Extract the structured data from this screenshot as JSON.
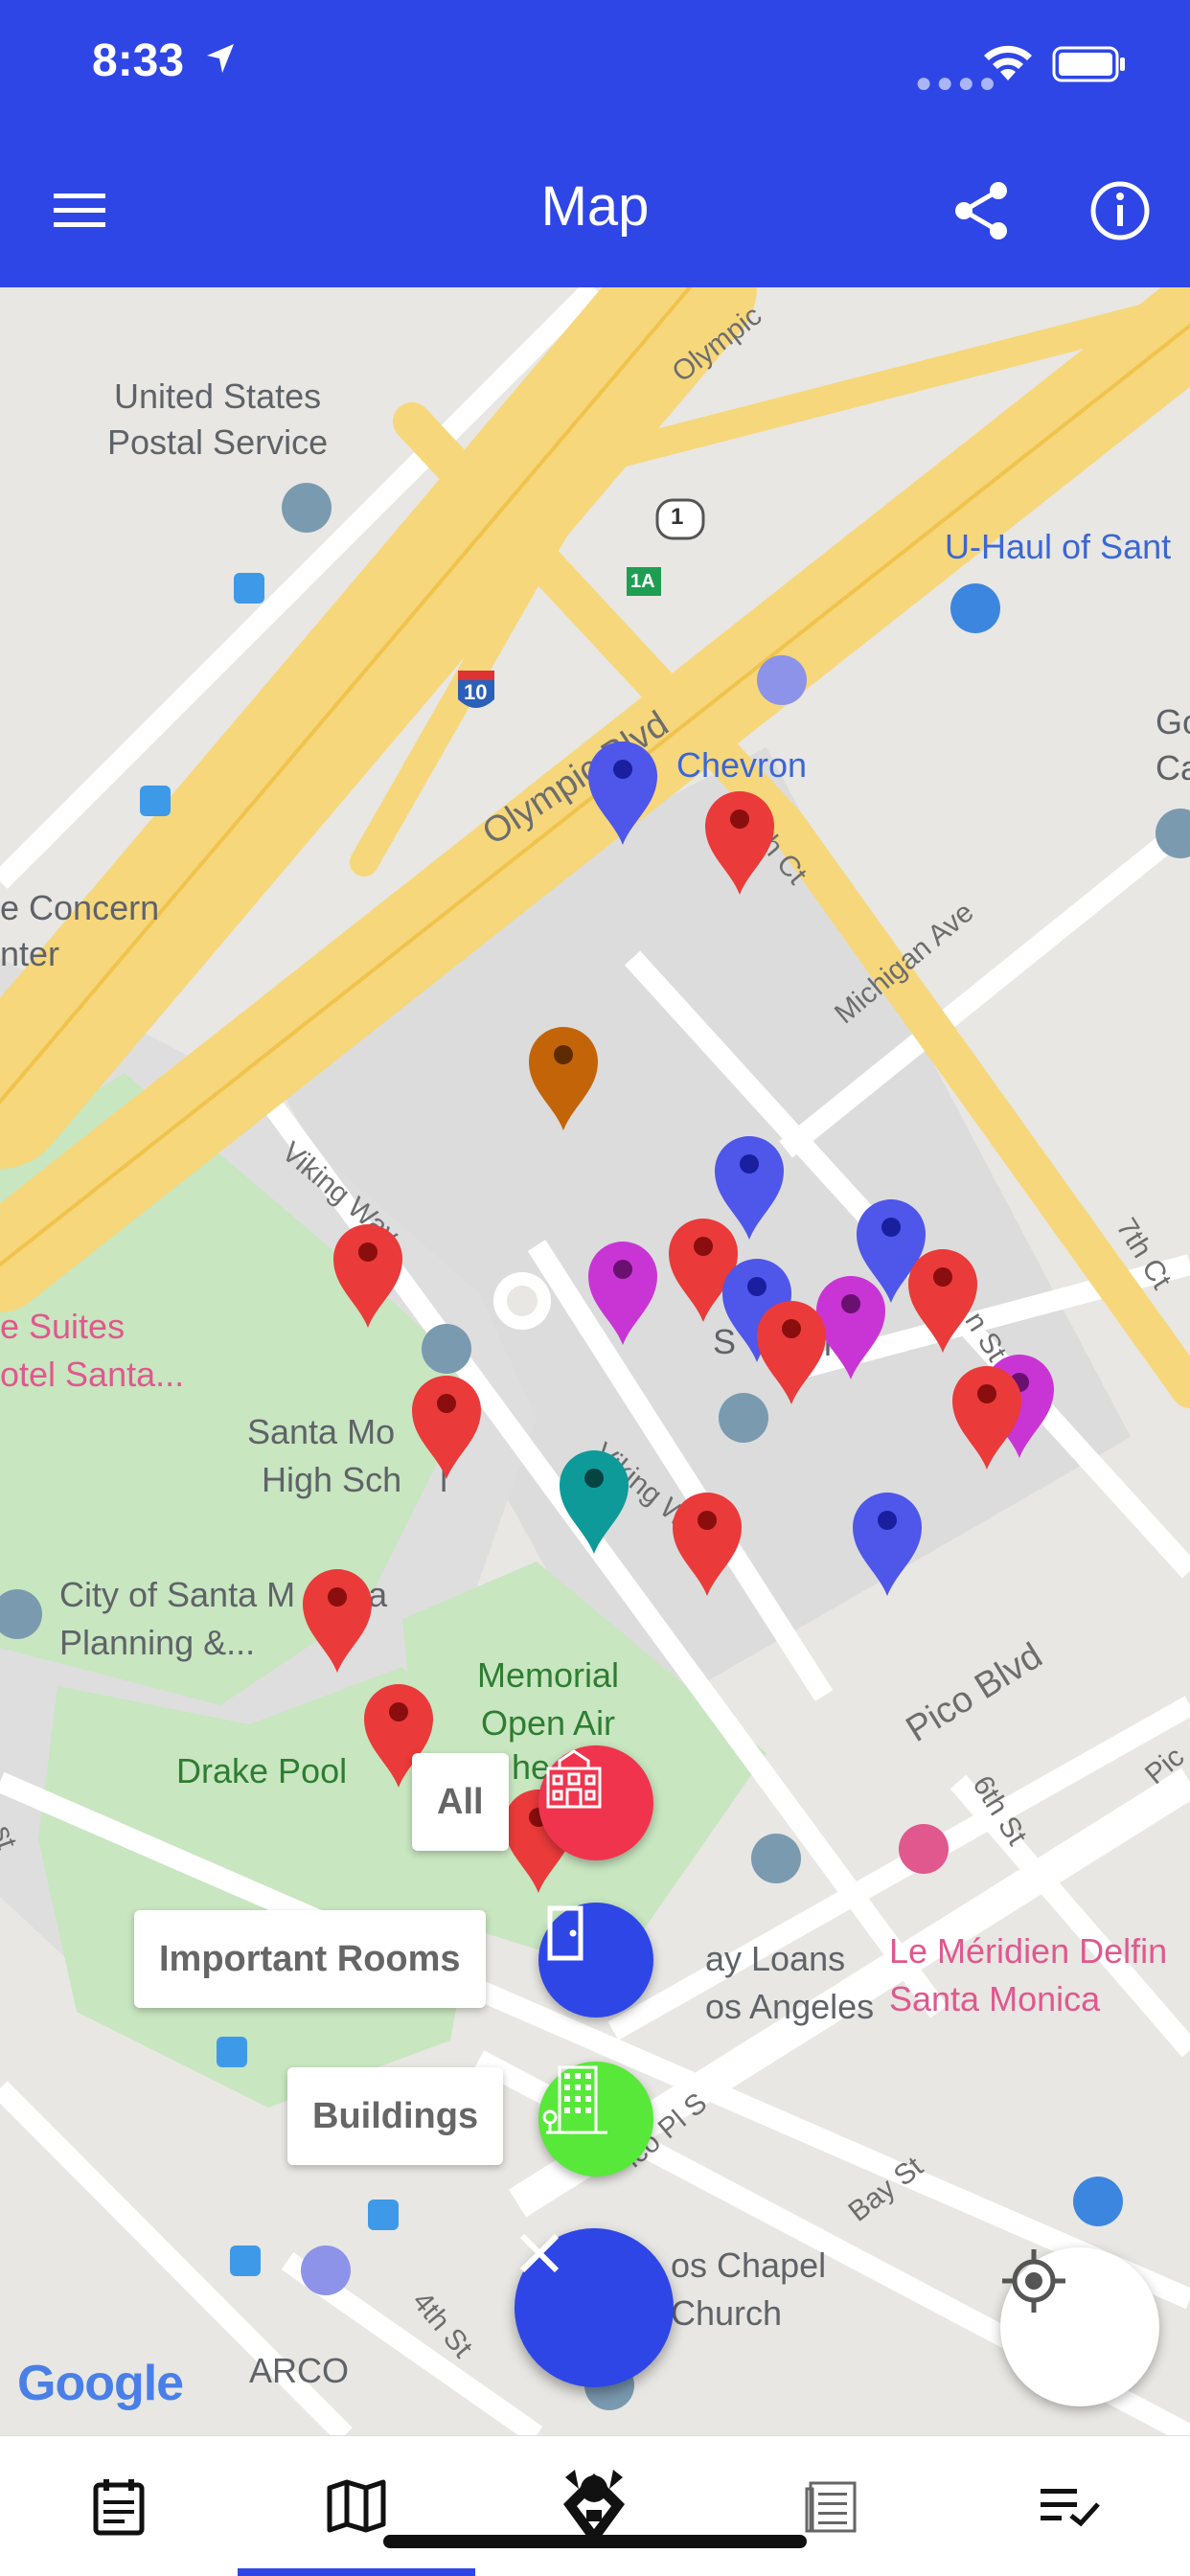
{
  "status_bar": {
    "time": "8:33"
  },
  "app_bar": {
    "title": "Map",
    "icons": [
      "menu-icon",
      "share-icon",
      "info-icon"
    ]
  },
  "map": {
    "places": {
      "post_office": "United States\nPostal Service",
      "uhaul": "U-Haul of Sant",
      "chevron": "Chevron",
      "gc_partial": "Go\nCa",
      "concern": "e Concern\nnter",
      "suites": "e Suites\notel Santa...",
      "high_school": "Santa Mo     a\nHigh Sch    l",
      "city_planning": "City of Santa M     ica\nPlanning &...",
      "drake_pool": "Drake Pool",
      "memorial": "Memorial\nOpen Air",
      "payday": "ay Loans\nos Angeles",
      "meridien": "Le Méridien Delfin\nSanta Monica",
      "chapel": "os Chapel\nChurch",
      "arco": "ARCO",
      "partial_s": "S",
      "partial_hi": "hi",
      "partial_he": "he"
    },
    "streets": {
      "olympic_top": "Olympic",
      "olympic_blvd": "Olympic Blvd",
      "michigan": "Michigan Ave",
      "viking_way": "Viking Way",
      "viking_w": "Viking W",
      "pico": "Pico Blvd",
      "seventh": "7th Ct",
      "sixth": "6th St",
      "bay": "Bay St",
      "fourth": "4th St",
      "pico_pl": "ico Pl S",
      "h_ct": "h Ct",
      "n_st": "n St",
      "pic": "Pic",
      "st_left": "st"
    },
    "shields": {
      "route1": "1",
      "route1a": "1A",
      "i10": "10"
    },
    "attribution": "Google"
  },
  "filters": {
    "all_label": "All",
    "important_rooms_label": "Important Rooms",
    "buildings_label": "Buildings",
    "colors": {
      "all": "#f0344e",
      "rooms": "#2f46e6",
      "buildings": "#58e83a"
    }
  },
  "markers": {
    "colors": {
      "red": "#ea3a3a",
      "blue": "#4f56ea",
      "magenta": "#c935d4",
      "teal": "#0f9a9a",
      "orange": "#c46408"
    }
  },
  "tab_bar": {
    "tabs": [
      "schedule-icon",
      "map-icon",
      "mascot-icon",
      "news-icon",
      "checklist-icon"
    ],
    "active": 1
  }
}
